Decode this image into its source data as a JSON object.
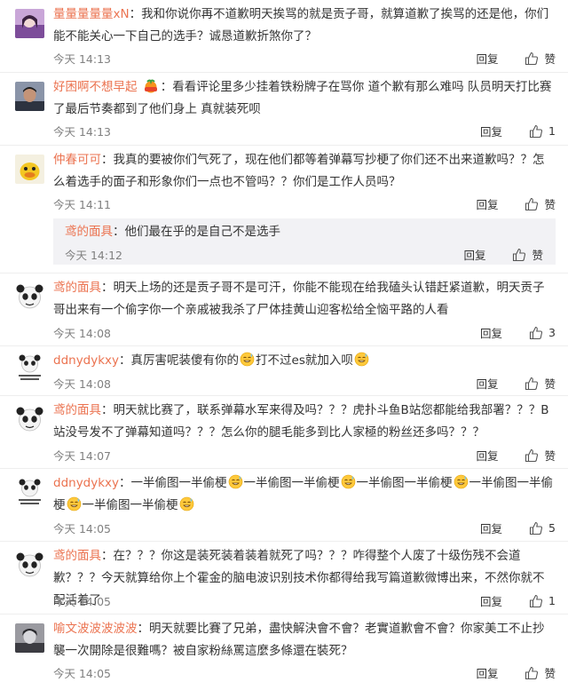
{
  "comments": [
    {
      "user": "量量量量量xN",
      "text": "我和你说你再不道歉明天挨骂的就是贡子哥，就算道歉了挨骂的还是他，你们能不能关心一下自己的选手？诚恳道歉折煞你了？",
      "time": "今天 14:13",
      "reply_label": "回复",
      "like_label": "赞",
      "avatar": "purple-girl-avatar"
    },
    {
      "user": "好困啊不想早起",
      "text": "看看评论里多少挂着铁粉牌子在骂你 道个歉有那么难吗 队员明天打比赛了最后节奏都到了他们身上 真就装死呗",
      "time": "今天 14:13",
      "reply_label": "回复",
      "like_label": "1",
      "avatar": "man-photo-avatar",
      "badge": "tangerine-badge-icon"
    },
    {
      "user": "仲春可可",
      "text": "我真的要被你们气死了，现在他们都等着弹幕写抄梗了你们还不出来道歉吗？？怎么着选手的面子和形象你们一点也不管吗？？你们是工作人员吗？",
      "time": "今天 14:11",
      "reply_label": "回复",
      "like_label": "赞",
      "avatar": "yellow-duck-avatar",
      "sub": {
        "user": "鸢的面具",
        "text": "他们最在乎的是自己不是选手",
        "time": "今天 14:12",
        "reply_label": "回复",
        "like_label": "赞"
      }
    },
    {
      "user": "鸢的面具",
      "text": "明天上场的还是贡子哥不是可汗，你能不能现在给我磕头认错赶紧道歉，明天贡子哥出来有一个偷字你一个亲戚被我杀了尸体挂黄山迎客松给全恼平路的人看",
      "time": "今天 14:08",
      "reply_label": "回复",
      "like_label": "3",
      "avatar": "panda-meme-avatar"
    },
    {
      "user": "ddnydykxy",
      "text": "真厉害呢装傻有你的",
      "text2": "打不过es就加入呗",
      "time": "今天 14:08",
      "reply_label": "回复",
      "like_label": "赞",
      "avatar": "panda-text-avatar"
    },
    {
      "user": "鸢的面具",
      "text": "明天就比赛了，联系弹幕水军来得及吗？？？虎扑斗鱼B站您都能给我部署？？？B站没号发不了弹幕知道吗？？？怎么你的腿毛能多到比人家極的粉丝还多吗？？？",
      "time": "今天 14:07",
      "reply_label": "回复",
      "like_label": "赞",
      "avatar": "panda-meme-avatar"
    },
    {
      "user": "ddnydykxy",
      "segments": [
        "一半偷图一半偷梗",
        "一半偷图一半偷梗",
        "一半偷图一半偷梗",
        "一半偷图一半偷梗",
        "一半偷图一半偷梗"
      ],
      "time": "今天 14:05",
      "reply_label": "回复",
      "like_label": "5",
      "avatar": "panda-text-avatar"
    },
    {
      "user": "鸢的面具",
      "text": "在？？？你这是装死装着装着就死了吗？？？咋得整个人废了十级伤残不会道歉？？？今天就算给你上个霍金的脑电波识别技术你都得给我写篇道歉微博出来，不然你就不配活着了",
      "time": "今天 14:05",
      "reply_label": "回复",
      "like_label": "1",
      "avatar": "panda-meme-avatar"
    },
    {
      "user": "喻文波波波波波",
      "text": "明天就要比賽了兄弟，盡快解決會不會？老實道歉會不會？你家美工不止抄襲一次開除是很難嗎？被自家粉絲罵這麼多條還在裝死？",
      "time": "今天 14:05",
      "reply_label": "回复",
      "like_label": "赞",
      "avatar": "gray-boy-avatar"
    }
  ]
}
